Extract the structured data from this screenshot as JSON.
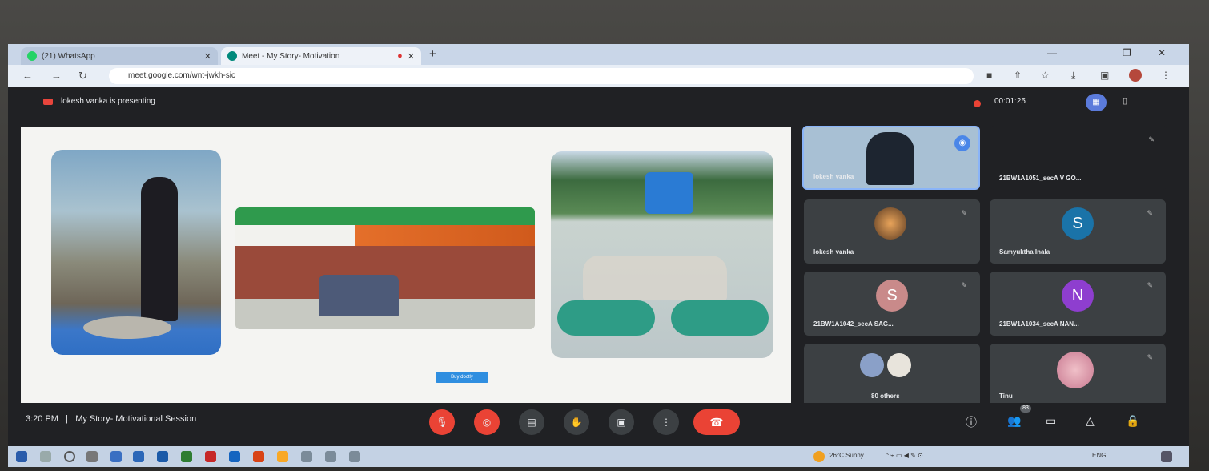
{
  "browser": {
    "tabs": [
      {
        "label": "(21) WhatsApp"
      },
      {
        "label": "Meet - My Story- Motivation"
      }
    ],
    "url": "meet.google.com/wnt-jwkh-sic"
  },
  "meet": {
    "presenting_text": "lokesh vanka is presenting",
    "recording_time": "00:01:25",
    "meeting_time": "3:20 PM",
    "meeting_title": "My Story- Motivational Session",
    "participants_badge": "83"
  },
  "slide": {
    "button_label": "Buy doctly"
  },
  "participants": [
    {
      "name": "lokesh vanka",
      "type": "video"
    },
    {
      "name": "21BW1A1051_secA V GO...",
      "type": "none"
    },
    {
      "name": "lokesh vanka",
      "type": "photo"
    },
    {
      "name": "Samyuktha Inala",
      "initial": "S",
      "color": "#1a73a8"
    },
    {
      "name": "21BW1A1042_secA SAG...",
      "initial": "S",
      "color": "#c98a8a"
    },
    {
      "name": "21BW1A1034_secA NAN...",
      "initial": "N",
      "color": "#8e3ecf"
    },
    {
      "name": "80 others",
      "type": "others"
    },
    {
      "name": "Tinu",
      "type": "photo"
    }
  ],
  "taskbar": {
    "weather": "26°C Sunny",
    "lang": "ENG"
  }
}
